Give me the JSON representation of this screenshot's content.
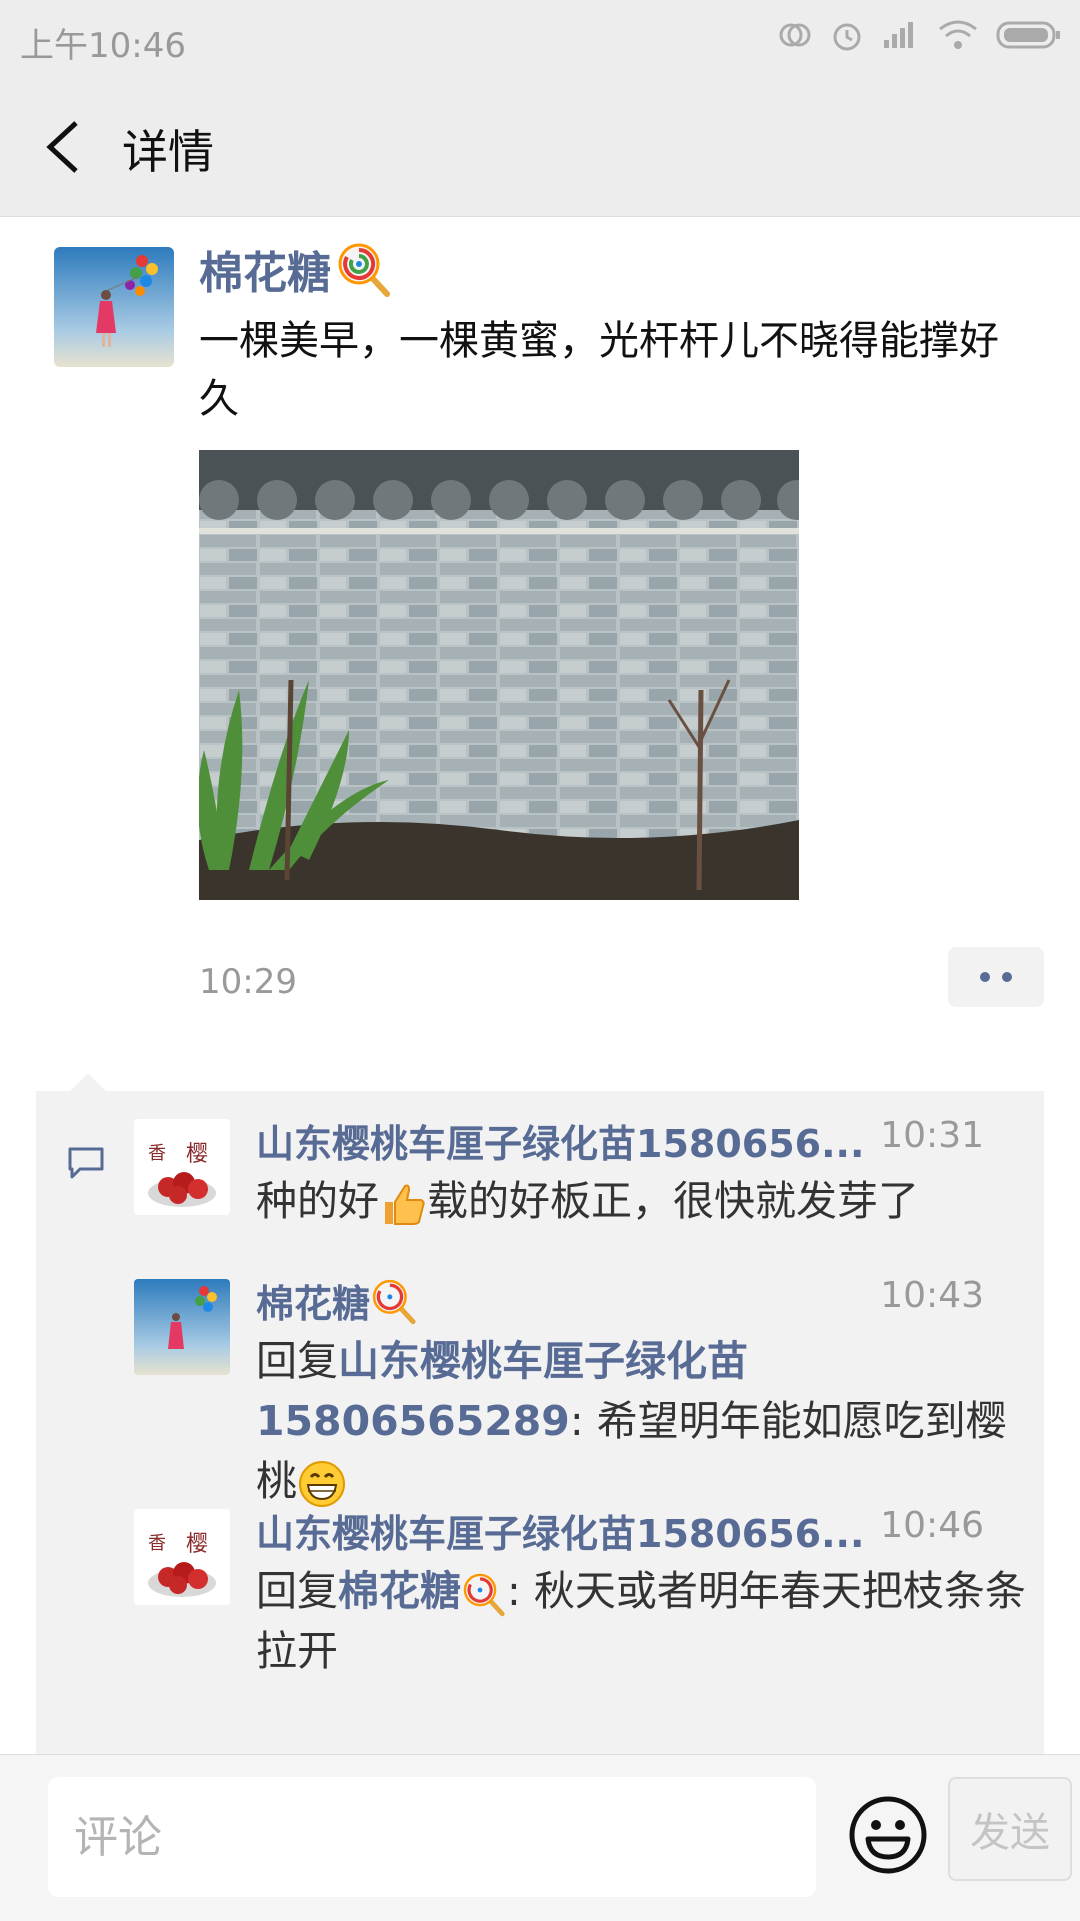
{
  "status_bar": {
    "time": "上午10:46"
  },
  "navbar": {
    "title": "详情"
  },
  "post": {
    "author": "棉花糖",
    "text": "一棵美早，一棵黄蜜，光杆杆儿不晓得能撑好久",
    "time": "10:29"
  },
  "comments": [
    {
      "name": "山东樱桃车厘子绿化苗1580656...",
      "time": "10:31",
      "text_a": "种的好",
      "text_b": "载的好板正，很快就发芽了"
    },
    {
      "name": "棉花糖",
      "time": "10:43",
      "reply_prefix": "回复",
      "reply_to": "山东樱桃车厘子绿化苗15806565289",
      "text": ": 希望明年能如愿吃到樱桃"
    },
    {
      "name": "山东樱桃车厘子绿化苗1580656...",
      "time": "10:46",
      "reply_prefix": "回复",
      "reply_to": "棉花糖",
      "text": ": 秋天或者明年春天把枝条条拉开"
    }
  ],
  "input": {
    "placeholder": "评论"
  },
  "send_label": "发送",
  "colors": {
    "link": "#576b95",
    "background": "#ededed",
    "comment_bg": "#f2f2f2"
  },
  "icons": [
    "back-arrow-icon",
    "lollipop-icon",
    "thumbs-up-icon",
    "grin-icon",
    "comment-bubble-icon",
    "smiley-icon",
    "more-dots-icon"
  ]
}
